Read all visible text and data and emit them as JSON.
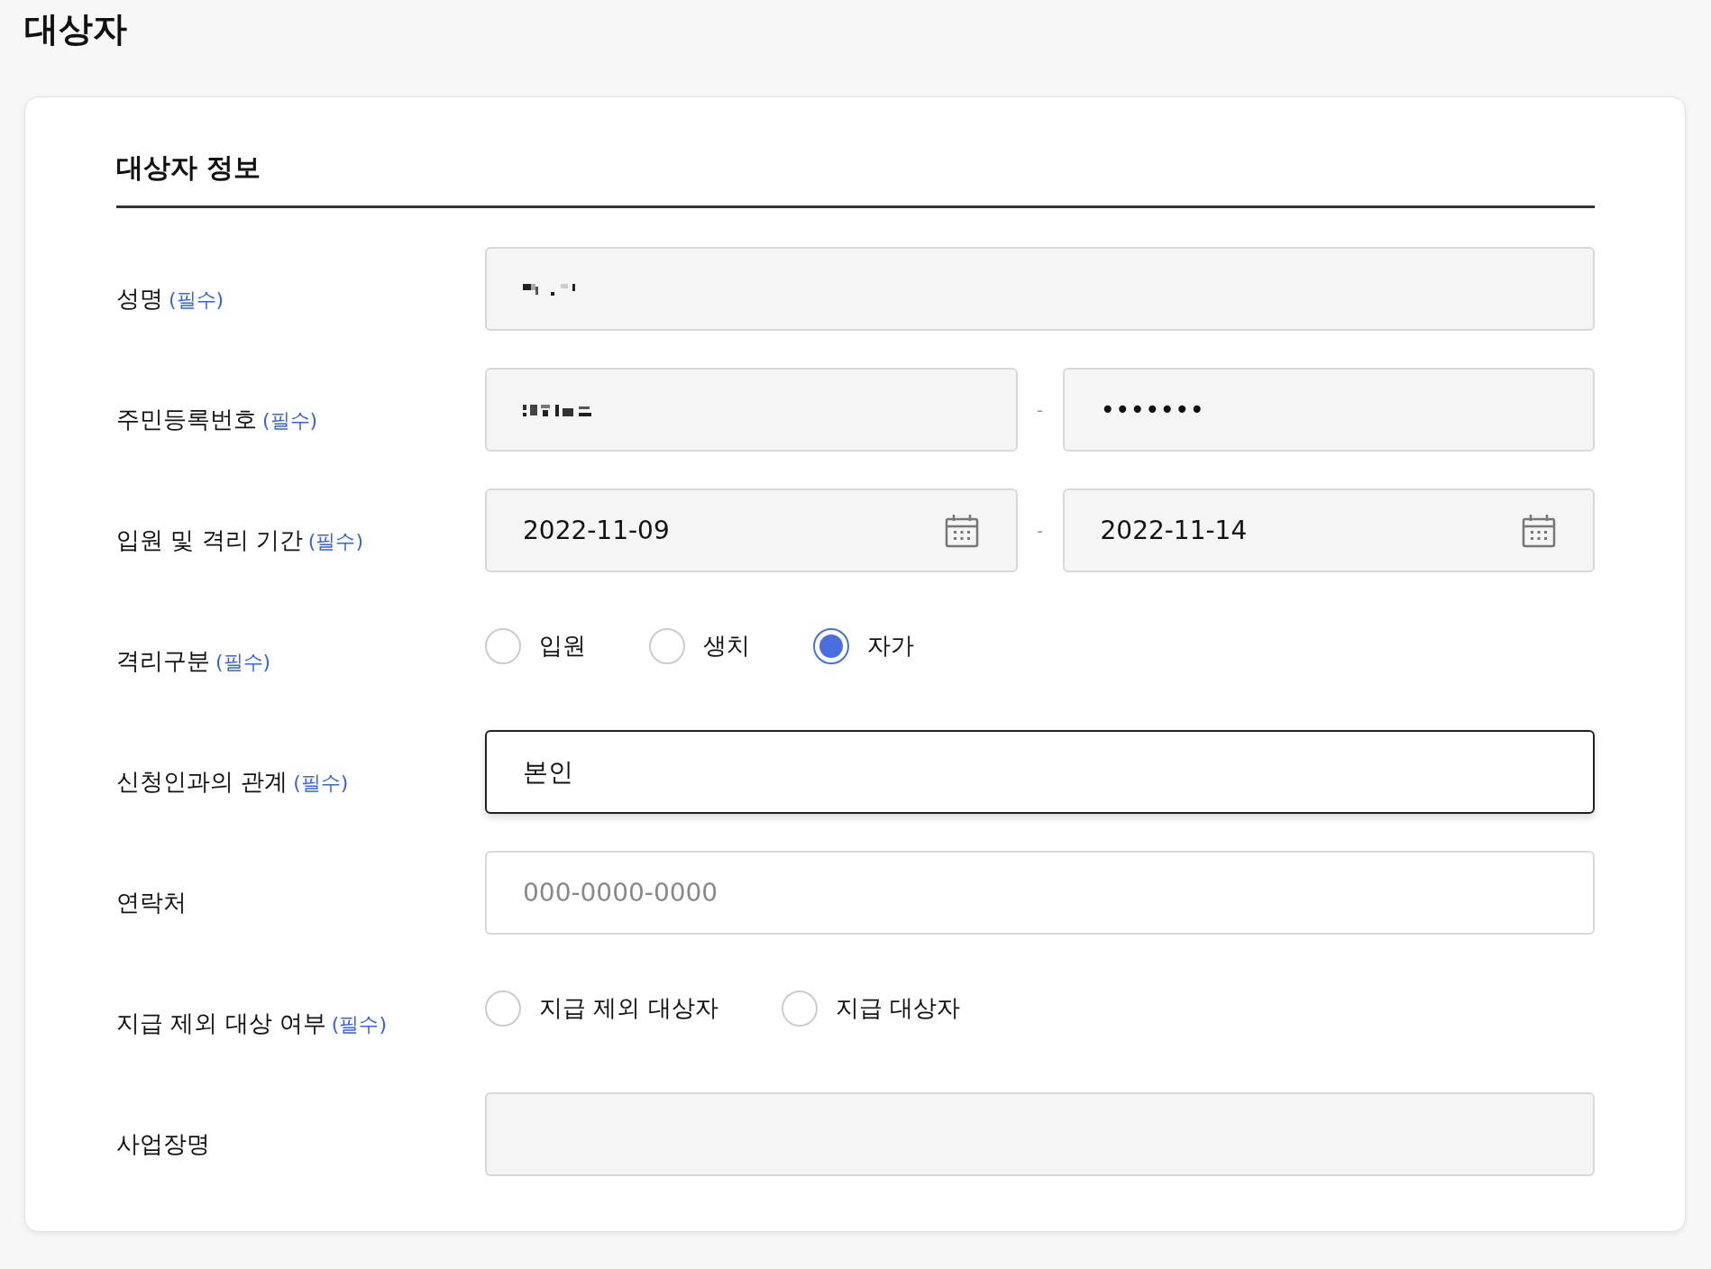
{
  "page_title": "대상자",
  "section_title": "대상자 정보",
  "rows": [
    {
      "kind": "text",
      "label": "성명",
      "required_mark": "(필수)",
      "fields": [
        {
          "masked": true,
          "focused": false
        }
      ]
    },
    {
      "kind": "pair",
      "label": "주민등록번호",
      "required_mark": "(필수)",
      "separator": "-",
      "fields": [
        {
          "masked": true,
          "focused": false
        },
        {
          "value": "•••••••",
          "focused": false
        }
      ]
    },
    {
      "kind": "dates",
      "label": "입원 및 격리 기간",
      "required_mark": "(필수)",
      "separator": "-",
      "fields": [
        {
          "value": "2022-11-09",
          "focused": false
        },
        {
          "value": "2022-11-14",
          "focused": false
        }
      ]
    },
    {
      "kind": "radio",
      "label": "격리구분",
      "required_mark": "(필수)",
      "options": [
        {
          "label": "입원",
          "selected": false
        },
        {
          "label": "생치",
          "selected": false
        },
        {
          "label": "자가",
          "selected": true
        }
      ]
    },
    {
      "kind": "text",
      "label": "신청인과의 관계",
      "required_mark": "(필수)",
      "fields": [
        {
          "value": "본인",
          "focused": true
        }
      ]
    },
    {
      "kind": "text",
      "label": "연락처",
      "fields": [
        {
          "placeholder": "000-0000-0000",
          "focused": false
        }
      ]
    },
    {
      "kind": "radio",
      "label": "지급 제외 대상 여부",
      "required_mark": "(필수)",
      "options": [
        {
          "label": "지급 제외 대상자",
          "selected": false
        },
        {
          "label": "지급 대상자",
          "selected": false
        }
      ]
    },
    {
      "kind": "text",
      "label": "사업장명",
      "fields": [
        {
          "focused": false
        }
      ]
    }
  ]
}
